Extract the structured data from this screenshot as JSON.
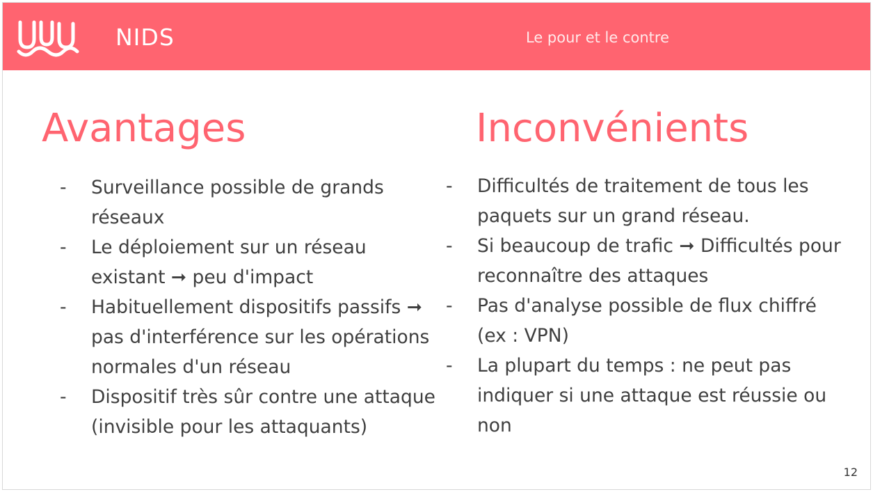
{
  "header": {
    "title": "NIDS",
    "subtitle": "Le pour et le contre",
    "logo_icon": "wave-logo-icon",
    "accent_color": "#ff6470"
  },
  "advantages": {
    "title": "Avantages",
    "items": [
      {
        "marker": "-",
        "text": "Surveillance possible de grands réseaux"
      },
      {
        "marker": "-",
        "text": "Le déploiement sur un réseau existant ➞ peu d'impact"
      },
      {
        "marker": "-",
        "text": "Habituellement dispositifs passifs ➞ pas d'interférence sur les opérations normales d'un réseau"
      },
      {
        "marker": "-",
        "text": "Dispositif très sûr contre une attaque (invisible pour les attaquants)"
      }
    ]
  },
  "disadvantages": {
    "title": "Inconvénients",
    "items": [
      {
        "marker": "-",
        "text": "Difficultés de traitement de tous les paquets sur un grand réseau."
      },
      {
        "marker": "-",
        "text": "Si beaucoup de trafic ➞ Difficultés pour reconnaître des attaques"
      },
      {
        "marker": "-",
        "text": "Pas d'analyse possible de flux chiffré (ex : VPN)"
      },
      {
        "marker": "-",
        "text": "La plupart du temps : ne peut pas indiquer si une attaque est réussie ou non"
      }
    ]
  },
  "page_number": "12"
}
